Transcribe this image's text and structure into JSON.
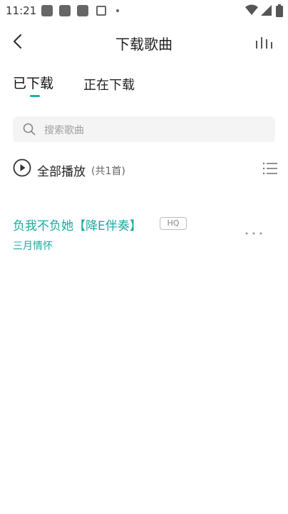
{
  "status_bar": {
    "time": "11:21",
    "notification_icons": [
      "app-icon",
      "app-icon",
      "app-icon",
      "app-a-icon"
    ],
    "right_icons": [
      "wifi-icon",
      "signal-icon",
      "battery-icon"
    ]
  },
  "header": {
    "title": "下载歌曲",
    "left_icon": "back-chevron-icon",
    "right_icon": "equalizer-bars-icon"
  },
  "tabs": [
    {
      "label": "已下载",
      "active": true
    },
    {
      "label": "正在下载",
      "active": false
    }
  ],
  "search": {
    "placeholder": "搜索歌曲"
  },
  "play_all": {
    "label": "全部播放",
    "count_text": "(共1首)"
  },
  "songs": [
    {
      "title": "负我不负她【降E伴奏】",
      "quality_badge": "HQ",
      "artist": "三月情怀"
    }
  ],
  "colors": {
    "accent": "#1aa9a1"
  }
}
